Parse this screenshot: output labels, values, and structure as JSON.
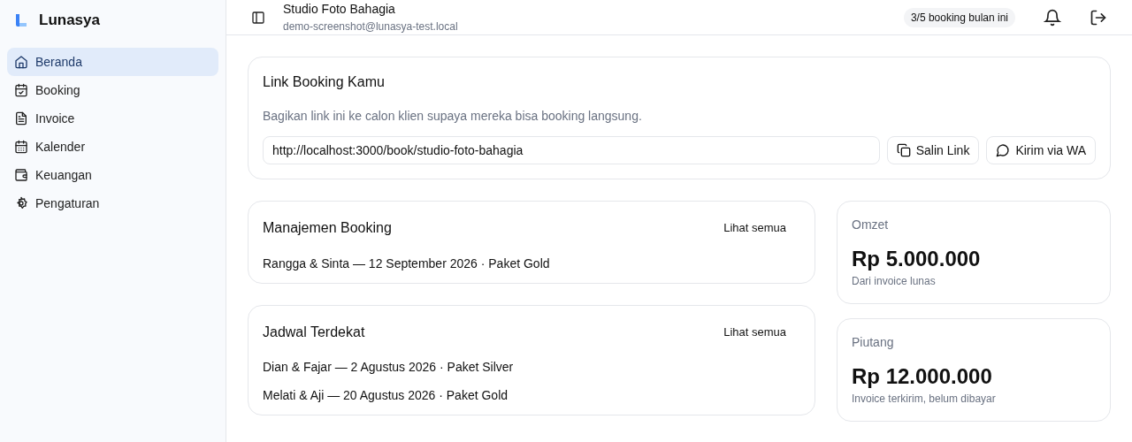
{
  "sidebar": {
    "brand": "Lunasya",
    "items": [
      {
        "label": "Beranda",
        "selected": true
      },
      {
        "label": "Booking",
        "selected": false
      },
      {
        "label": "Invoice",
        "selected": false
      },
      {
        "label": "Kalender",
        "selected": false
      },
      {
        "label": "Keuangan",
        "selected": false
      },
      {
        "label": "Pengaturan",
        "selected": false
      }
    ]
  },
  "header": {
    "title": "Studio Foto Bahagia",
    "email": "demo-screenshot@lunasya-test.local",
    "quota_badge": "3/5 booking bulan ini"
  },
  "link_card": {
    "title": "Link Booking Kamu",
    "description": "Bagikan link ini ke calon klien supaya mereka bisa booking langsung.",
    "url": "http://localhost:3000/book/studio-foto-bahagia",
    "buttons": [
      "Salin Link",
      "Kirim via WA"
    ]
  },
  "lists": [
    {
      "title": "Manajemen Booking",
      "action": "Lihat semua",
      "items": [
        "Rangga & Sinta — 12 September 2026 · Paket Gold"
      ]
    },
    {
      "title": "Jadwal Terdekat",
      "action": "Lihat semua",
      "items": [
        "Dian & Fajar — 2 Agustus 2026 · Paket Silver",
        "Melati & Aji — 20 Agustus 2026 · Paket Gold"
      ]
    }
  ],
  "stats": [
    {
      "label": "Omzet",
      "value": "Rp 5.000.000",
      "note": "Dari invoice lunas"
    },
    {
      "label": "Piutang",
      "value": "Rp 12.000.000",
      "note": "Invoice terkirim, belum dibayar"
    }
  ]
}
